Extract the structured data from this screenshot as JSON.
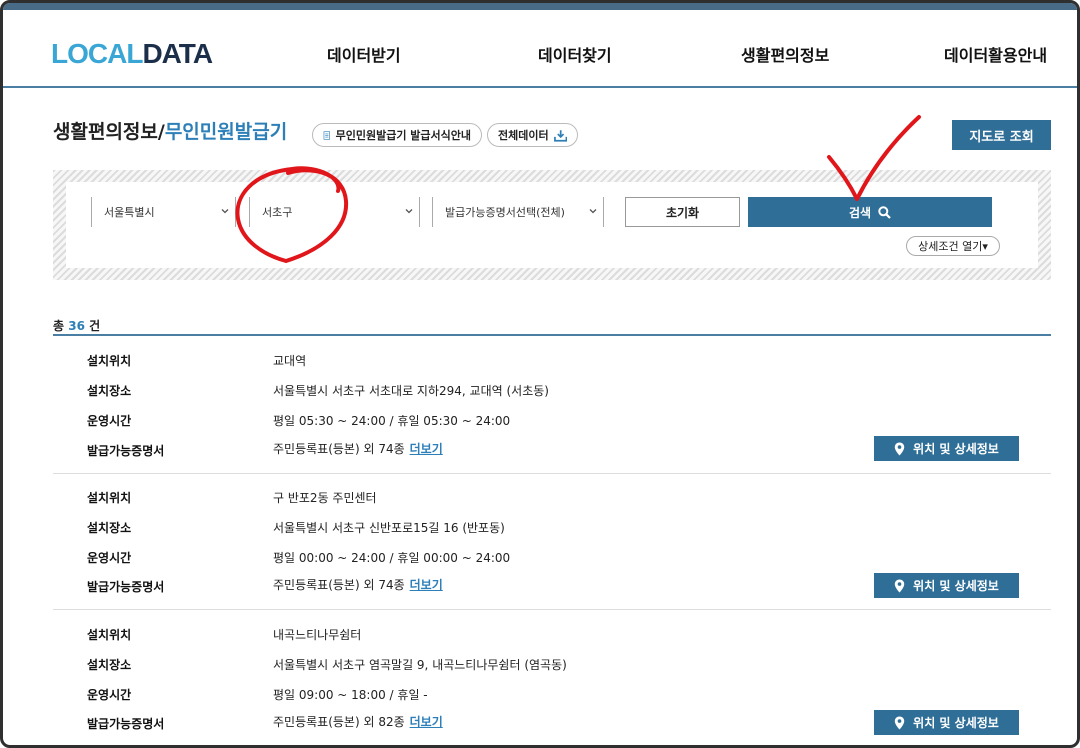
{
  "header": {
    "logo_part1": "LOCAL",
    "logo_part2": "DATA",
    "nav": [
      "데이터받기",
      "데이터찾기",
      "생활편의정보",
      "데이터활용안내"
    ]
  },
  "page": {
    "title_main": "생활편의정보/",
    "title_sub": "무인민원발급기",
    "guide_button": "무인민원발급기 발급서식안내",
    "all_data_button": "전체데이터",
    "map_button": "지도로 조회"
  },
  "search": {
    "city": "서울특별시",
    "district": "서초구",
    "certificate": "발급가능증명서선택(전체)",
    "reset_label": "초기화",
    "search_label": "검색",
    "detail_toggle": "상세조건 열기▾"
  },
  "summary": {
    "prefix": "총",
    "count": "36",
    "suffix": "건"
  },
  "labels": {
    "location": "설치위치",
    "place": "설치장소",
    "hours": "운영시간",
    "certs": "발급가능증명서",
    "more": "더보기",
    "detail_button": "위치 및 상세정보"
  },
  "results": [
    {
      "location": "교대역",
      "place": "서울특별시 서초구 서초대로 지하294, 교대역 (서초동)",
      "hours": "평일 05:30 ~ 24:00 / 휴일 05:30 ~ 24:00",
      "certs": "주민등록표(등본) 외 74종"
    },
    {
      "location": "구 반포2동 주민센터",
      "place": "서울특별시 서초구 신반포로15길 16 (반포동)",
      "hours": "평일 00:00 ~ 24:00 / 휴일 00:00 ~ 24:00",
      "certs": "주민등록표(등본) 외 74종"
    },
    {
      "location": "내곡느티나무쉼터",
      "place": "서울특별시 서초구 염곡말길 9, 내곡느티나무쉼터 (염곡동)",
      "hours": "평일 09:00 ~ 18:00 / 휴일 -",
      "certs": "주민등록표(등본) 외 82종"
    }
  ],
  "colors": {
    "accent": "#2f6e97",
    "link": "#2d7fb8",
    "annotation": "#e0161a"
  }
}
